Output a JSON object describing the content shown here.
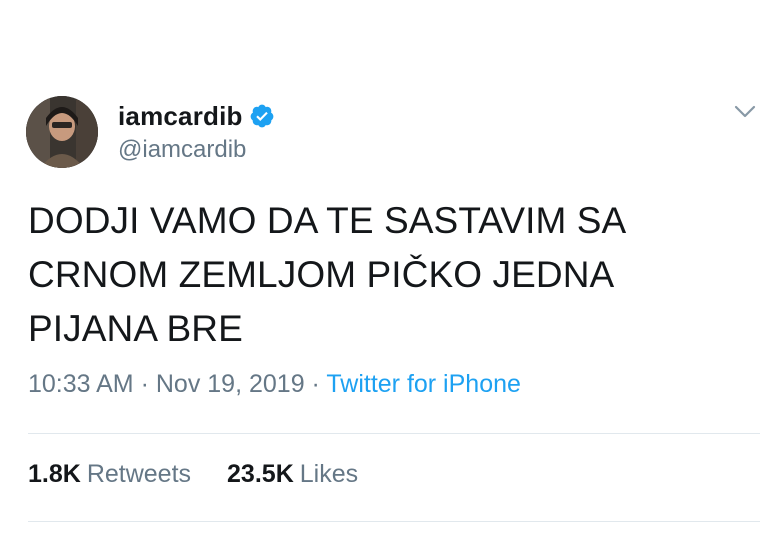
{
  "user": {
    "display_name": "iamcardib",
    "handle": "@iamcardib",
    "verified_icon": "verified-badge-icon"
  },
  "tweet": {
    "lines": "DODJI VAMO DA TE SASTAVIM SA\nCRNOM ZEMLJOM PIČKO JEDNA\nPIJANA BRE",
    "time": "10:33 AM",
    "separator": "·",
    "date": "Nov 19, 2019",
    "source": "Twitter for iPhone"
  },
  "stats": {
    "retweets_count": "1.8K",
    "retweets_label": "Retweets",
    "likes_count": "23.5K",
    "likes_label": "Likes"
  },
  "icons": {
    "menu": "chevron-down-icon"
  },
  "colors": {
    "verified_blue": "#1da1f2",
    "secondary_text": "#657786",
    "link": "#1da1f2"
  }
}
